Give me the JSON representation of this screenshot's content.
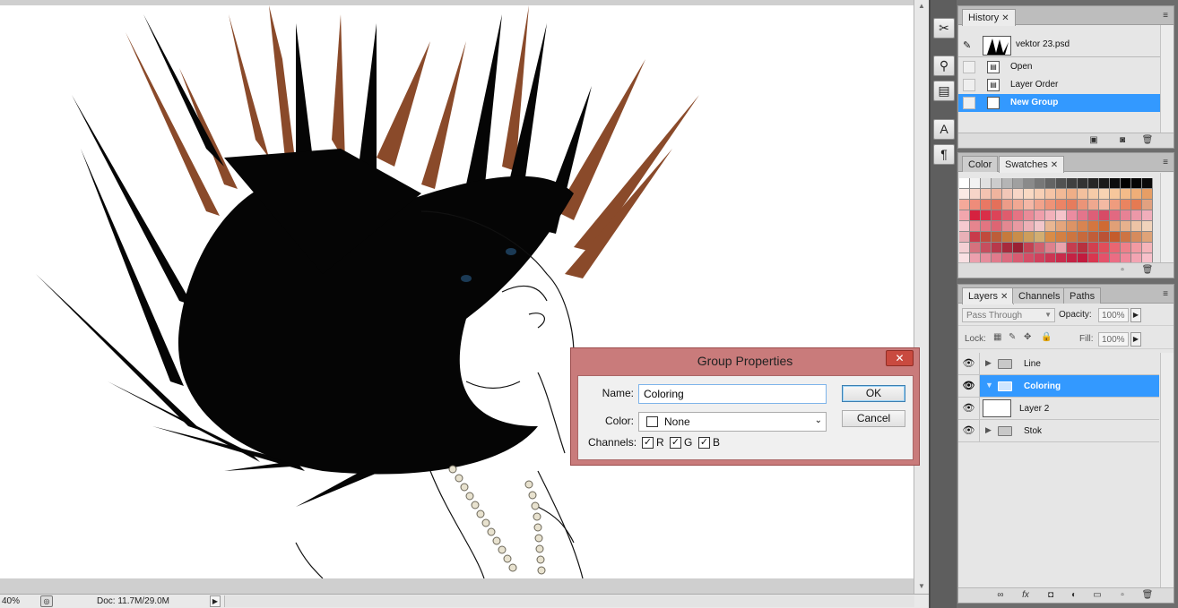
{
  "status_bar": {
    "zoom": "40%",
    "doc": "Doc: 11.7M/29.0M"
  },
  "mini_tools": [
    "tools-icon",
    "clone-source-icon",
    "brush-presets-icon",
    "character-icon",
    "paragraph-icon"
  ],
  "history": {
    "tab": "History",
    "snapshot": "vektor 23.psd",
    "items": [
      {
        "label": "Open"
      },
      {
        "label": "Layer Order"
      },
      {
        "label": "New Group"
      }
    ]
  },
  "swatches": {
    "tabs": [
      "Color",
      "Swatches"
    ],
    "colors": [
      "#ffffff",
      "#f2f2f2",
      "#e0e0e0",
      "#cccccc",
      "#b5b5b5",
      "#a0a0a0",
      "#8a8a8a",
      "#777777",
      "#646464",
      "#525252",
      "#404040",
      "#333333",
      "#262626",
      "#1a1a1a",
      "#0d0d0d",
      "#000000",
      "#050505",
      "#0a0a0a",
      "#fbe9e4",
      "#f6d4c8",
      "#f3c3b1",
      "#efb49e",
      "#f2c7b7",
      "#f7d6c6",
      "#f9d9c3",
      "#f7cfb5",
      "#f5c4a6",
      "#f2b996",
      "#efae87",
      "#f3c09d",
      "#f6cba8",
      "#f8d3b3",
      "#f6c79c",
      "#f3bb89",
      "#efae78",
      "#e79e65",
      "#f4a99a",
      "#ee8c7a",
      "#e97864",
      "#e4705a",
      "#ec9c88",
      "#f1a893",
      "#f4b7a6",
      "#f1a38c",
      "#ee9378",
      "#eb8466",
      "#e67c5d",
      "#eb9478",
      "#efa88f",
      "#f3b9a3",
      "#ef9c7e",
      "#ea8460",
      "#e57a52",
      "#e2a180",
      "#f1a6ad",
      "#d6213f",
      "#d92f48",
      "#dc4458",
      "#df5c6d",
      "#e57383",
      "#ea8b98",
      "#ef9fab",
      "#f2b1ba",
      "#f5c3ca",
      "#eb8ca0",
      "#e4758b",
      "#dd5f77",
      "#d74b66",
      "#e26981",
      "#e78295",
      "#ec98a8",
      "#f1aebb",
      "#f5c9cf",
      "#e6858e",
      "#e27581",
      "#de6573",
      "#e38891",
      "#e89aa2",
      "#edb0b6",
      "#f2c6ca",
      "#e9b692",
      "#e4a57c",
      "#dd9365",
      "#d98451",
      "#d47640",
      "#cf6a34",
      "#e1a077",
      "#e7b18d",
      "#edc3a5",
      "#f1d3bb",
      "#e8b0b7",
      "#c83b4b",
      "#c14a3d",
      "#bd5d39",
      "#c67a3c",
      "#c98d4a",
      "#cd9e5c",
      "#d2ae72",
      "#d98c47",
      "#d38043",
      "#cd7540",
      "#c7693c",
      "#c15d39",
      "#bb5235",
      "#c45c2c",
      "#cd7444",
      "#d68b5d",
      "#dfa378",
      "#f3cfd3",
      "#d5727e",
      "#c64e5e",
      "#b8394b",
      "#a72a3c",
      "#9a2033",
      "#c24253",
      "#d0606f",
      "#de818d",
      "#e9a3ac",
      "#c53d4f",
      "#b8313f",
      "#d2404f",
      "#e14e5a",
      "#e96672",
      "#ee808a",
      "#f29aa2",
      "#f5b4ba",
      "#f9e0e3",
      "#eca0ad",
      "#e68d9c",
      "#e17b8c",
      "#dc6a7e",
      "#d85b71",
      "#d44d66",
      "#d0405c",
      "#cc3553",
      "#c82b4b",
      "#c42244",
      "#c21b3e",
      "#d9364f",
      "#e4526a",
      "#eb6d83",
      "#f0899b",
      "#f3a4b2",
      "#f7c0ca"
    ]
  },
  "layers": {
    "tabs": [
      "Layers",
      "Channels",
      "Paths"
    ],
    "blend_mode": "Pass Through",
    "opacity_label": "Opacity:",
    "opacity": "100%",
    "lock_label": "Lock:",
    "fill_label": "Fill:",
    "fill": "100%",
    "rows": [
      {
        "name": "Line",
        "type": "group"
      },
      {
        "name": "Coloring",
        "type": "group",
        "selected": true
      },
      {
        "name": "Layer 2",
        "type": "layer"
      },
      {
        "name": "Stok",
        "type": "group"
      }
    ]
  },
  "dialog": {
    "title": "Group Properties",
    "name_label": "Name:",
    "name_value": "Coloring",
    "color_label": "Color:",
    "color_value": "None",
    "channels_label": "Channels:",
    "channels": [
      "R",
      "G",
      "B"
    ],
    "ok": "OK",
    "cancel": "Cancel"
  },
  "colors": {
    "selection": "#3399ff",
    "dialog_frame": "#c97b7b",
    "close_button": "#c94a3f",
    "hair_brown": "#8a4a2a"
  }
}
